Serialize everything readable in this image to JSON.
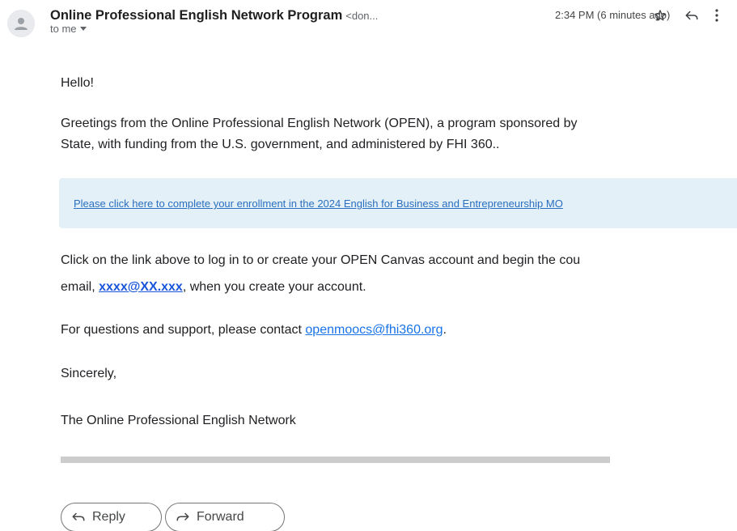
{
  "email": {
    "sender_name": "Online Professional English Network Program",
    "sender_email": "<don...",
    "timestamp": "2:34 PM (6 minutes ago)",
    "recipient": "to me"
  },
  "body": {
    "greeting": "Hello!",
    "intro_line1": "Greetings from the Online Professional English Network (OPEN), a program sponsored by",
    "intro_line2": "State, with funding from the U.S. government, and administered by FHI 360..",
    "enroll_link": "Please click here to complete your enrollment in the 2024 English for Business and Entrepreneurship MO",
    "instruction_line1": "Click on the link above to log in to or create your OPEN Canvas account and begin the cou",
    "instruction_line2_prefix": "email, ",
    "instruction_email": "xxxx@XX.xxx",
    "instruction_line2_suffix": ", when you create your account.",
    "support_prefix": "For questions and support, please contact ",
    "support_email": "openmoocs@fhi360.org",
    "support_suffix": ".",
    "closing": "Sincerely,",
    "signature": "The Online Professional English Network"
  },
  "actions": {
    "reply_label": "Reply",
    "forward_label": "Forward"
  },
  "icons": {
    "avatar": "person-icon",
    "star": "star-icon",
    "reply": "reply-icon",
    "more": "more-vertical-icon",
    "forward": "forward-icon",
    "caret": "caret-down-icon"
  },
  "colors": {
    "link_box_bg": "#e3f0f8",
    "link": "#1a73e8"
  }
}
